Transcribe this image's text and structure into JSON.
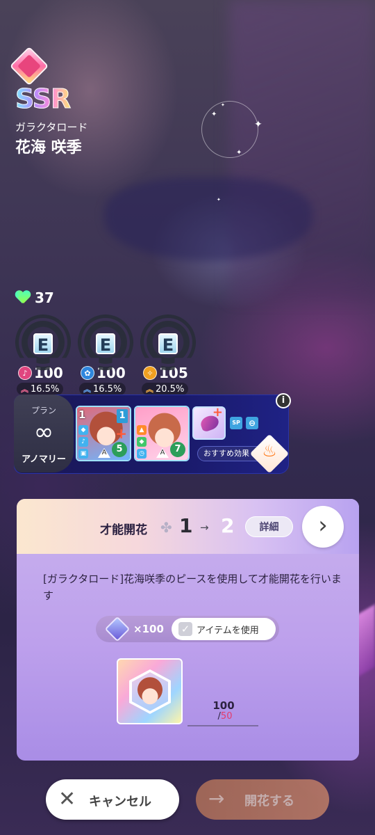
{
  "card": {
    "rarity": "SSR",
    "subtitle": "ガラクタロード",
    "name": "花海 咲季"
  },
  "stamina": {
    "value": "37",
    "icon": "heart-icon"
  },
  "stats": [
    {
      "rank": "E",
      "icon": "vocal-icon",
      "value": "100",
      "percent": "16.5%",
      "color": "#e0457f"
    },
    {
      "rank": "E",
      "icon": "dance-icon",
      "value": "100",
      "percent": "16.5%",
      "color": "#2f86dd"
    },
    {
      "rank": "E",
      "icon": "visual-icon",
      "value": "105",
      "percent": "20.5%",
      "color": "#f0a020"
    }
  ],
  "plan": {
    "label": "プラン",
    "name": "アノマリー",
    "icon": "infinity-icon"
  },
  "support_cards": [
    {
      "level_left": "1",
      "level_right": "1",
      "count": "5"
    },
    {
      "level_left": "",
      "level_right": "",
      "count": "7"
    }
  ],
  "recommend_label": "おすすめ効果",
  "badges": {
    "sp": "SP"
  },
  "panel": {
    "title": "才能開花",
    "from": "1",
    "arrow": "→",
    "to": "2",
    "detail_label": "詳細",
    "description": "[ガラクタロード]花海咲季のピースを使用して才能開花を行います",
    "item_qty": "×100",
    "use_item_label": "アイテムを使用",
    "owned": "100",
    "need_sep": "/",
    "need": "50"
  },
  "buttons": {
    "cancel": "キャンセル",
    "bloom": "開花する"
  }
}
